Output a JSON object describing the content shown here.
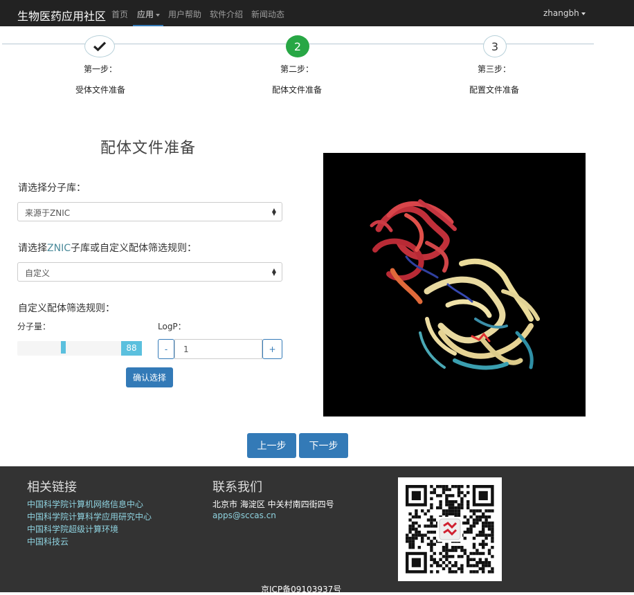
{
  "navbar": {
    "brand": "生物医药应用社区",
    "items": [
      {
        "label": "首页"
      },
      {
        "label": "应用"
      },
      {
        "label": "用户帮助"
      },
      {
        "label": "软件介绍"
      },
      {
        "label": "新闻动态"
      }
    ],
    "user": "zhangbh"
  },
  "steps": [
    {
      "number": "",
      "title": "第一步：",
      "desc": "受体文件准备",
      "status": "done"
    },
    {
      "number": "2",
      "title": "第二步：",
      "desc": "配体文件准备",
      "status": "current"
    },
    {
      "number": "3",
      "title": "第三步：",
      "desc": "配置文件准备",
      "status": "future"
    }
  ],
  "form": {
    "title": "配体文件准备",
    "library_label": "请选择分子库：",
    "library_value": "来源于ZNIC",
    "rule_label_prefix": "请选择",
    "rule_label_highlight": "ZNIC",
    "rule_label_suffix": "子库或自定义配体筛选规则：",
    "rule_value": "自定义",
    "custom_label": "自定义配体筛选规则：",
    "mw_label": "分子量：",
    "mw_value": "88",
    "mw_fraction": 0.36,
    "logp_label": "LogP：",
    "logp_minus": "-",
    "logp_value": "1",
    "logp_plus": "+",
    "confirm_label": "确认选择"
  },
  "nav_buttons": {
    "prev": "上一步",
    "next": "下一步"
  },
  "footer": {
    "links_heading": "相关链接",
    "links": [
      {
        "label": "中国科学院计算机网络信息中心"
      },
      {
        "label": "中国科学院计算科学应用研究中心"
      },
      {
        "label": "中国科学院超级计算环境"
      },
      {
        "label": "中国科技云"
      }
    ],
    "contact_heading": "联系我们",
    "address": "北京市 海淀区 中关村南四街四号",
    "email": "apps@sccas.cn",
    "icp": "京ICP备09103937号"
  },
  "colors": {
    "navbar_bg": "#222222",
    "primary": "#337ab7",
    "step_current": "#28a745",
    "slider": "#5bc0de",
    "footer_bg": "#333333",
    "footer_link": "#8fd3e0"
  },
  "icons": {
    "step_done": "checkmark-icon",
    "dropdown": "caret-down-icon",
    "select": "select-arrows-icon",
    "qr": "qr-code-icon",
    "viewer": "protein-structure"
  }
}
